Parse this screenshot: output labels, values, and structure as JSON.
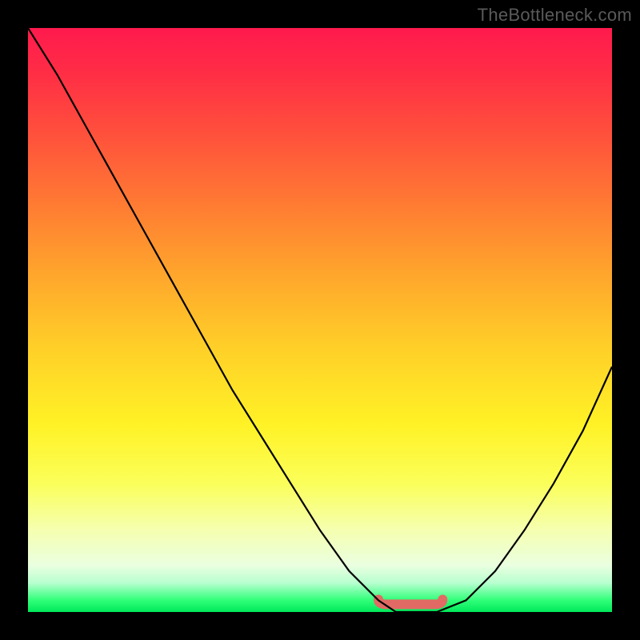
{
  "watermark": "TheBottleneck.com",
  "chart_data": {
    "type": "line",
    "title": "",
    "xlabel": "",
    "ylabel": "",
    "xlim": [
      0,
      1
    ],
    "ylim": [
      0,
      1
    ],
    "background": {
      "style": "vertical-gradient",
      "stops": [
        {
          "pos": 0.0,
          "color": "#ff1a4d"
        },
        {
          "pos": 0.18,
          "color": "#ff503c"
        },
        {
          "pos": 0.42,
          "color": "#ffa52c"
        },
        {
          "pos": 0.68,
          "color": "#fff226"
        },
        {
          "pos": 0.92,
          "color": "#eaffe0"
        },
        {
          "pos": 1.0,
          "color": "#00e85a"
        }
      ]
    },
    "series": [
      {
        "name": "bottleneck-curve",
        "color": "#000000",
        "x": [
          0.0,
          0.05,
          0.1,
          0.15,
          0.2,
          0.25,
          0.3,
          0.35,
          0.4,
          0.45,
          0.5,
          0.55,
          0.6,
          0.63,
          0.66,
          0.7,
          0.75,
          0.8,
          0.85,
          0.9,
          0.95,
          1.0
        ],
        "y": [
          1.0,
          0.92,
          0.83,
          0.74,
          0.65,
          0.56,
          0.47,
          0.38,
          0.3,
          0.22,
          0.14,
          0.07,
          0.02,
          0.0,
          0.0,
          0.0,
          0.02,
          0.07,
          0.14,
          0.22,
          0.31,
          0.42
        ]
      }
    ],
    "annotations": [
      {
        "name": "optimal-flat-region",
        "color": "#e26a64",
        "x_range": [
          0.6,
          0.71
        ],
        "y": 0.005
      }
    ]
  }
}
